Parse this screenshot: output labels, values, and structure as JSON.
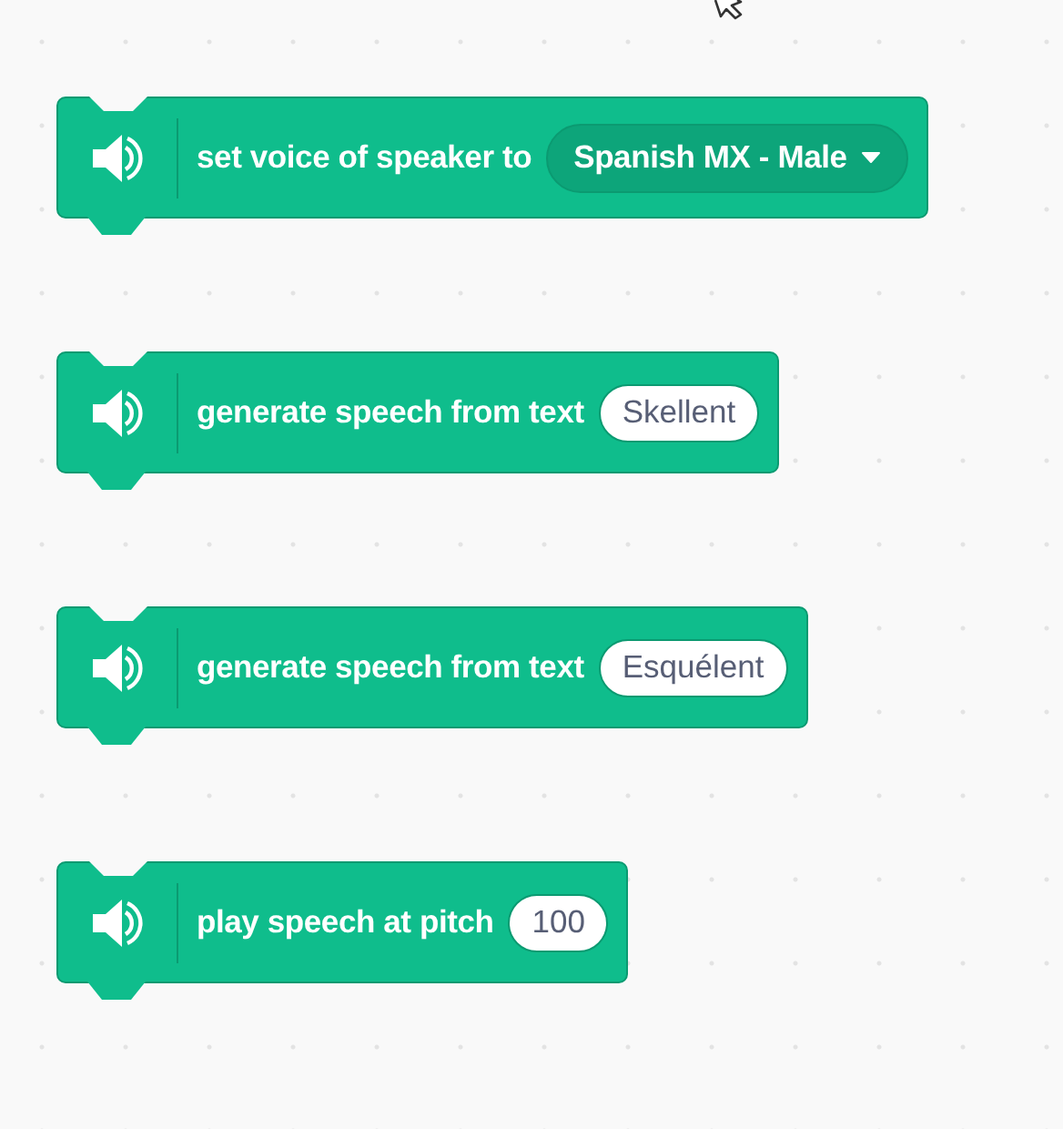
{
  "blocks": [
    {
      "kind": "dropdown",
      "label": "set voice of speaker to",
      "value": "Spanish MX - Male"
    },
    {
      "kind": "text_input",
      "label": "generate speech from text",
      "value": "Skellent"
    },
    {
      "kind": "text_input",
      "label": "generate speech from text",
      "value": "Esquélent"
    },
    {
      "kind": "number_input",
      "label": "play speech at pitch",
      "value": "100"
    }
  ]
}
